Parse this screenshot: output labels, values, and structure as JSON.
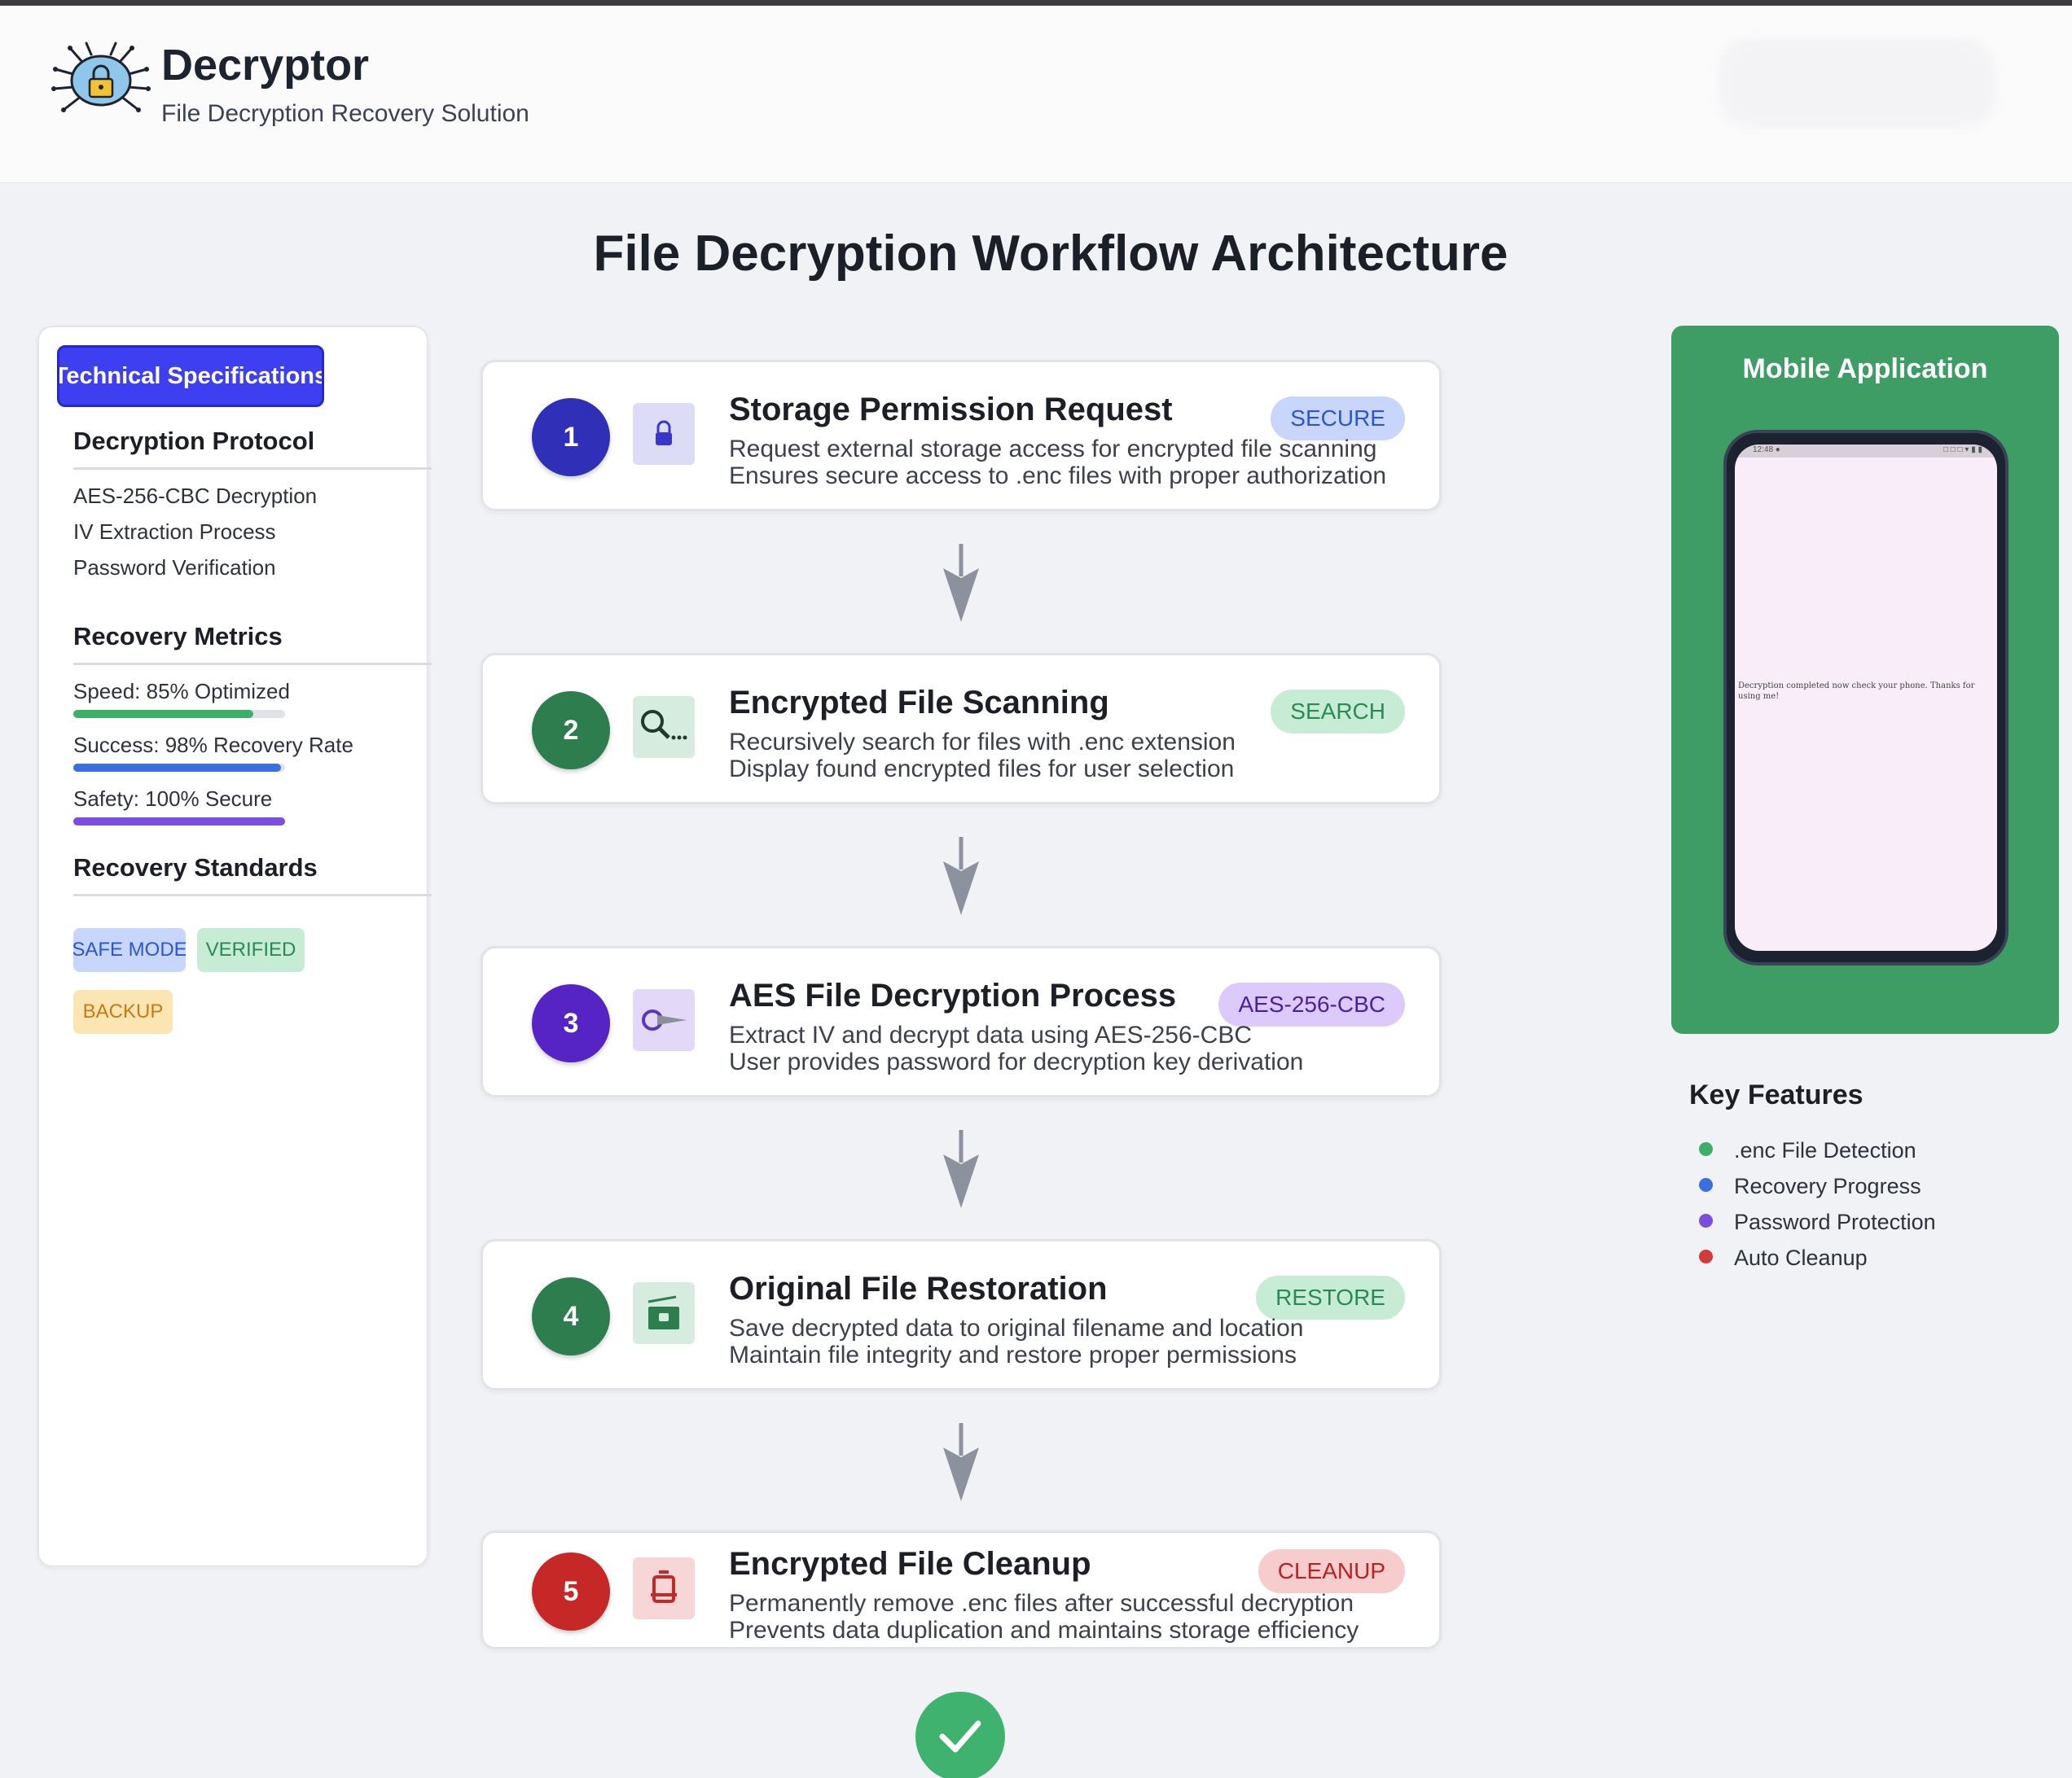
{
  "app": {
    "title": "Decryptor",
    "subtitle": "File Decryption Recovery Solution"
  },
  "page_title": "File Decryption Workflow Architecture",
  "spec_panel": {
    "tab_label": "Technical Specifications",
    "protocol": {
      "title": "Decryption Protocol",
      "items": [
        "AES-256-CBC Decryption",
        "IV Extraction Process",
        "Password Verification"
      ]
    },
    "metrics": {
      "title": "Recovery Metrics",
      "items": [
        {
          "label": "Speed: 85% Optimized",
          "value": 0.85,
          "color": "#3fae6b"
        },
        {
          "label": "Success: 98% Recovery Rate",
          "value": 0.98,
          "color": "#3b6fe0"
        },
        {
          "label": "Safety: 100% Secure",
          "value": 1.0,
          "color": "#7a4fe0"
        }
      ]
    },
    "standards": {
      "title": "Recovery Standards",
      "badges": [
        "SAFE MODE",
        "VERIFIED",
        "BACKUP"
      ]
    }
  },
  "steps": [
    {
      "number": "1",
      "title": "Storage Permission Request",
      "tag": "SECURE",
      "desc1": "Request external storage access for encrypted file scanning",
      "desc2": "Ensures secure access to .enc files with proper authorization",
      "icon": "lock-icon",
      "color": "#2f2fb8"
    },
    {
      "number": "2",
      "title": "Encrypted File Scanning",
      "tag": "SEARCH",
      "desc1": "Recursively search for files with .enc extension",
      "desc2": "Display found encrypted files for user selection",
      "icon": "search-icon",
      "color": "#2e7d4f"
    },
    {
      "number": "3",
      "title": "AES File Decryption Process",
      "tag": "AES-256-CBC",
      "desc1": "Extract IV and decrypt data using AES-256-CBC",
      "desc2": "User provides password for decryption key derivation",
      "icon": "key-icon",
      "color": "#5624c4"
    },
    {
      "number": "4",
      "title": "Original File Restoration",
      "tag": "RESTORE",
      "desc1": "Save decrypted data to original filename and location",
      "desc2": "Maintain file integrity and restore proper permissions",
      "icon": "folder-icon",
      "color": "#2e7d4f"
    },
    {
      "number": "5",
      "title": "Encrypted File Cleanup",
      "tag": "CLEANUP",
      "desc1": "Permanently remove .enc files after successful decryption",
      "desc2": "Prevents data duplication and maintains storage efficiency",
      "icon": "trash-icon",
      "color": "#c62828"
    }
  ],
  "mobile": {
    "title": "Mobile Application",
    "status_left": "12:48 ●",
    "status_right": "□ □ □ ▾ ▮ ▮",
    "message": "Decryption completed now check your phone. Thanks for using me!"
  },
  "features": {
    "title": "Key Features",
    "items": [
      {
        "label": ".enc File Detection",
        "color": "#3fae6b"
      },
      {
        "label": "Recovery Progress",
        "color": "#3b6fe0"
      },
      {
        "label": "Password Protection",
        "color": "#7a4fe0"
      },
      {
        "label": "Auto Cleanup",
        "color": "#d43a3a"
      }
    ]
  }
}
